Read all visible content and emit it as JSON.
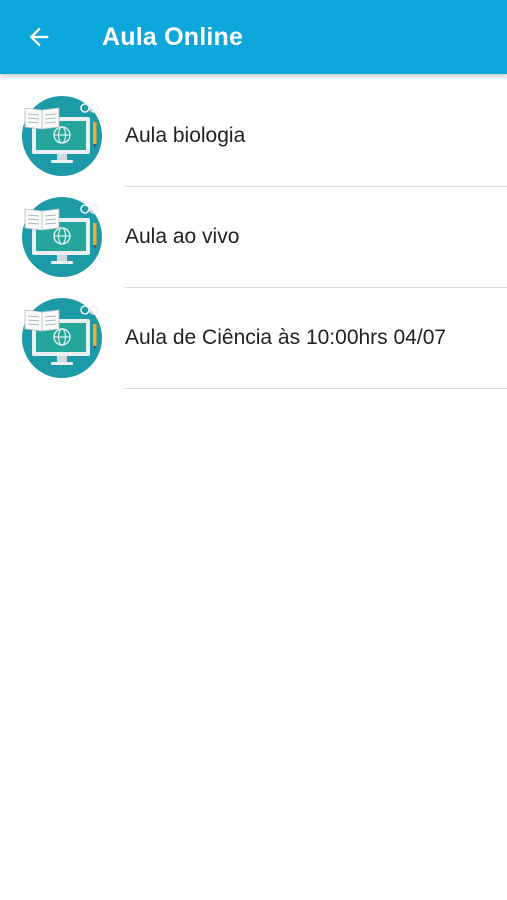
{
  "app_bar": {
    "title": "Aula Online",
    "back_icon": "arrow-left-icon",
    "background_color": "#0ea7dc"
  },
  "list": {
    "icon": "online-class-icon",
    "items": [
      {
        "label": "Aula biologia"
      },
      {
        "label": "Aula ao vivo"
      },
      {
        "label": "Aula de Ciência às 10:00hrs 04/07"
      }
    ]
  }
}
